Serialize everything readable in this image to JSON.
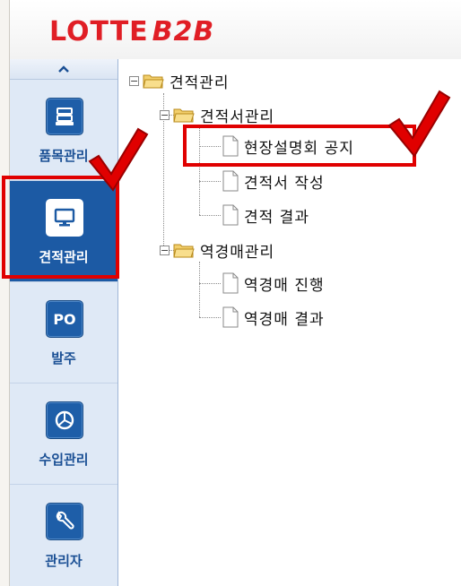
{
  "header": {
    "logo_main": "LOTTE",
    "logo_sub": "B2B"
  },
  "sidebar": {
    "collapse_icon": "chevron-up-icon",
    "items": [
      {
        "label": "품목관리",
        "icon": "box-stack-icon",
        "active": false
      },
      {
        "label": "견적관리",
        "icon": "monitor-icon",
        "active": true
      },
      {
        "label": "발주",
        "icon": "po-icon",
        "icon_text": "PO",
        "active": false
      },
      {
        "label": "수입관리",
        "icon": "pie-chart-icon",
        "active": false
      },
      {
        "label": "관리자",
        "icon": "wrench-icon",
        "active": false
      }
    ]
  },
  "tree": {
    "root": "견적관리",
    "groups": [
      {
        "label": "견적서관리",
        "children": [
          "현장설명회 공지",
          "견적서 작성",
          "견적 결과"
        ]
      },
      {
        "label": "역경매관리",
        "children": [
          "역경매 진행",
          "역경매 결과"
        ]
      }
    ],
    "toggle_symbol": "−"
  },
  "colors": {
    "brand_red": "#e01e25",
    "sidebar_active": "#1c5aa4",
    "highlight_red": "#e00000"
  }
}
